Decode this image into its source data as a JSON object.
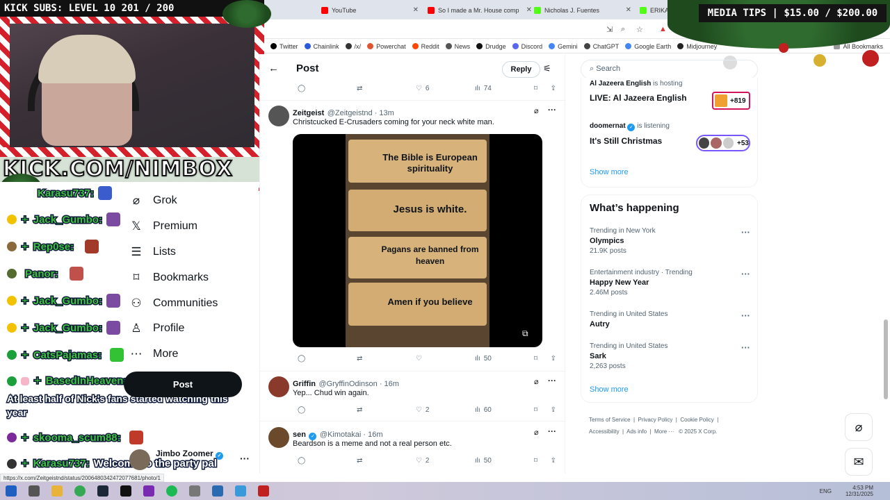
{
  "overlay": {
    "kick_subs": "KICK SUBS: LEVEL 10 201 / 200",
    "media_tips": "MEDIA TIPS | $15.00 / $200.00",
    "kick_url": "KICK.COM/NIMBOX"
  },
  "browser": {
    "tabs": [
      {
        "label": "YouTube",
        "color": "#ff0000"
      },
      {
        "label": "So I made a Mr. House comp",
        "color": "#ff0000"
      },
      {
        "label": "Nicholas J. Fuentes",
        "color": "#53fc18"
      },
      {
        "label": "ERIKA DE",
        "color": "#53fc18"
      }
    ],
    "bookmarks": [
      {
        "label": "Twitter",
        "color": "#000000"
      },
      {
        "label": "Chainlink",
        "color": "#2a5ada"
      },
      {
        "label": "/x/",
        "color": "#333333"
      },
      {
        "label": "Powerchat",
        "color": "#e0542f"
      },
      {
        "label": "Reddit",
        "color": "#ff4500"
      },
      {
        "label": "News",
        "color": "#555555"
      },
      {
        "label": "Drudge",
        "color": "#111111"
      },
      {
        "label": "Discord",
        "color": "#5865f2"
      },
      {
        "label": "Gemini",
        "color": "#4285f4"
      },
      {
        "label": "ChatGPT",
        "color": "#444444"
      },
      {
        "label": "Google Earth",
        "color": "#4285f4"
      },
      {
        "label": "Midjourney",
        "color": "#222222"
      }
    ],
    "all_bookmarks": "All Bookmarks",
    "status_url": "https://x.com/Zeitgeistnd/status/2006480342472077681/photo/1"
  },
  "chat": {
    "messages": [
      {
        "user": "Karasu737:",
        "text": "",
        "badge": "#3a5ccc"
      },
      {
        "user": "Jack_Gumbo:",
        "text": "",
        "badge": "#f2c200"
      },
      {
        "user": "Rep0se:",
        "text": "",
        "badge": "#8a6a3a"
      },
      {
        "user": "Panor:",
        "text": "",
        "badge": "#556b2f"
      },
      {
        "user": "Jack_Gumbo:",
        "text": "",
        "badge": "#f2c200"
      },
      {
        "user": "Jack_Gumbo:",
        "text": "",
        "badge": "#f2c200"
      },
      {
        "user": "CatsPajamas:",
        "text": "",
        "badge": "#1a9f3a"
      },
      {
        "user": "BasedInHeaven:",
        "text": "At least half of Nick's fans started watching this year",
        "badge": "#1a9f3a"
      },
      {
        "user": "skooma_scum88:",
        "text": "",
        "badge": "#7a2a9a"
      },
      {
        "user": "Karasu737:",
        "text": "Welcome to the party pal",
        "badge": "#333333"
      }
    ]
  },
  "x": {
    "nav": [
      {
        "label": "Grok",
        "icon": "grok-icon",
        "glyph": "⌀"
      },
      {
        "label": "Premium",
        "icon": "x-logo-icon",
        "glyph": "𝕏"
      },
      {
        "label": "Lists",
        "icon": "list-icon",
        "glyph": "☰"
      },
      {
        "label": "Bookmarks",
        "icon": "bookmark-icon",
        "glyph": "⌑"
      },
      {
        "label": "Communities",
        "icon": "communities-icon",
        "glyph": "⚇"
      },
      {
        "label": "Profile",
        "icon": "profile-icon",
        "glyph": "♙"
      },
      {
        "label": "More",
        "icon": "more-circle-icon",
        "glyph": "⋯"
      }
    ],
    "post_button": "Post",
    "account": {
      "name": "Jimbo Zoomer"
    },
    "header": {
      "title": "Post",
      "reply": "Reply"
    },
    "top_actions": {
      "likes": "6",
      "views": "74"
    },
    "tweets": [
      {
        "name": "Zeitgeist",
        "handle": "@Zeitgeistnd · 13m",
        "text": "Christcucked E-Crusaders coming for your neck white man.",
        "likes": "",
        "views": "50"
      },
      {
        "name": "Griffin",
        "handle": "@GryffinOdinson · 16m",
        "text": "Yep... Chud win again.",
        "likes": "2",
        "views": "60"
      },
      {
        "name": "sen",
        "handle": "@Kimotakai · 16m",
        "text": "Beardson is a meme and not a real person etc.",
        "likes": "2",
        "views": "50"
      }
    ],
    "image_lines": [
      "The Bible is European spirituality",
      "Jesus is white.",
      "Pagans are banned from heaven",
      "Amen if you believe"
    ]
  },
  "right": {
    "search_placeholder": "Search",
    "spaces": [
      {
        "host": "Al Jazeera English",
        "status": "is hosting",
        "title": "LIVE: Al Jazeera English",
        "count": "+819"
      },
      {
        "host": "doomernat",
        "status": "is listening",
        "title": "It's Still Christmas",
        "count": "+53"
      }
    ],
    "show_more": "Show more",
    "whats_happening": "What’s happening",
    "trends": [
      {
        "context": "Trending in New York",
        "topic": "Olympics",
        "posts": "21.9K posts"
      },
      {
        "context": "Entertainment industry · Trending",
        "topic": "Happy New Year",
        "posts": "2.46M posts"
      },
      {
        "context": "Trending in United States",
        "topic": "Autry",
        "posts": ""
      },
      {
        "context": "Trending in United States",
        "topic": "Sark",
        "posts": "2,263 posts"
      }
    ],
    "show_more_2": "Show more",
    "footer": [
      "Terms of Service",
      "Privacy Policy",
      "Cookie Policy",
      "Accessibility",
      "Ads info",
      "More ···",
      "© 2025 X Corp."
    ]
  },
  "taskbar": {
    "lang": "ENG",
    "time": "4:53 PM",
    "date": "12/31/2025"
  }
}
